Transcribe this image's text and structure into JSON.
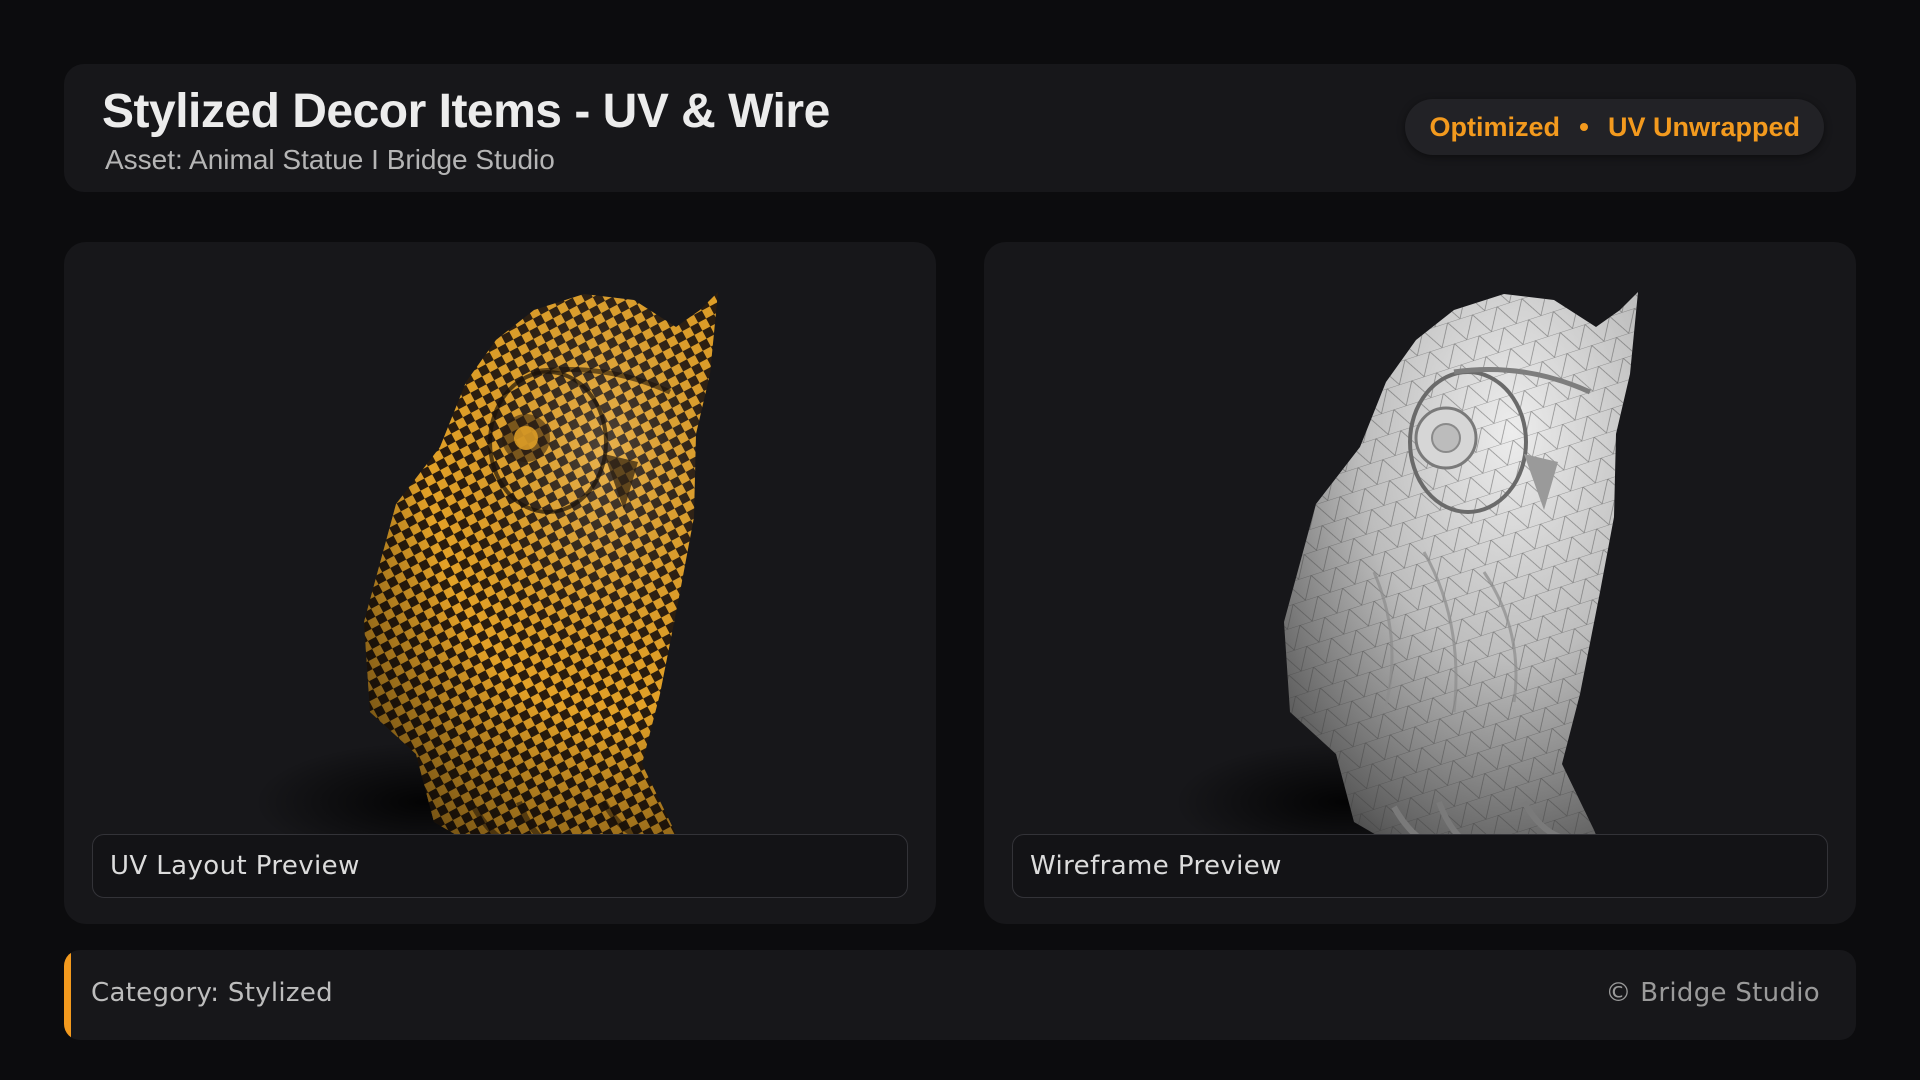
{
  "header": {
    "title": "Stylized Decor Items - UV & Wire",
    "subtitle": "Asset: Animal Statue  I  Bridge Studio",
    "tags": [
      "Optimized",
      "UV Unwrapped"
    ]
  },
  "previews": [
    {
      "label": "UV Layout Preview",
      "render": "owl-statue-checker-texture"
    },
    {
      "label": "Wireframe Preview",
      "render": "owl-statue-wireframe"
    }
  ],
  "footer": {
    "category": "Category: Stylized",
    "copyright": "© Bridge Studio"
  },
  "colors": {
    "accent": "#f39a1e",
    "background": "#0c0c0e",
    "panel": "#17171a",
    "checker_dark": "#2a1c0e",
    "checker_light": "#e3a127"
  }
}
